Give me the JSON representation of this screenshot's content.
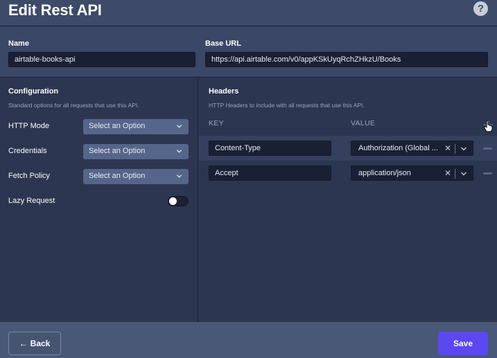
{
  "page": {
    "title": "Edit Rest API",
    "help": "?"
  },
  "form": {
    "name_label": "Name",
    "name_value": "airtable-books-api",
    "base_url_label": "Base URL",
    "base_url_value": "https://api.airtable.com/v0/appKSkUyqRchZHkzU/Books"
  },
  "configuration": {
    "title": "Configuration",
    "description": "Standard options for all requests that use this API.",
    "rows": [
      {
        "label": "HTTP Mode",
        "value": "Select an Option"
      },
      {
        "label": "Credentials",
        "value": "Select an Option"
      },
      {
        "label": "Fetch Policy",
        "value": "Select an Option"
      }
    ],
    "lazy_label": "Lazy Request",
    "lazy_on": false
  },
  "headers": {
    "title": "Headers",
    "description": "HTTP Headers to include with all requests that use this API.",
    "key_col": "KEY",
    "value_col": "VALUE",
    "rows": [
      {
        "key": "Content-Type",
        "value": "Authorization (Global ..."
      },
      {
        "key": "Accept",
        "value": "application/json"
      }
    ]
  },
  "footer": {
    "back_label": "Back",
    "save_label": "Save"
  },
  "colors": {
    "primary": "#5b48f0",
    "panel": "#2c3650",
    "header": "#3d4a68"
  },
  "icons": [
    "help-icon",
    "chevron-down-icon",
    "clear-icon",
    "add-icon",
    "remove-icon",
    "arrow-left-icon",
    "hand-cursor-icon"
  ]
}
